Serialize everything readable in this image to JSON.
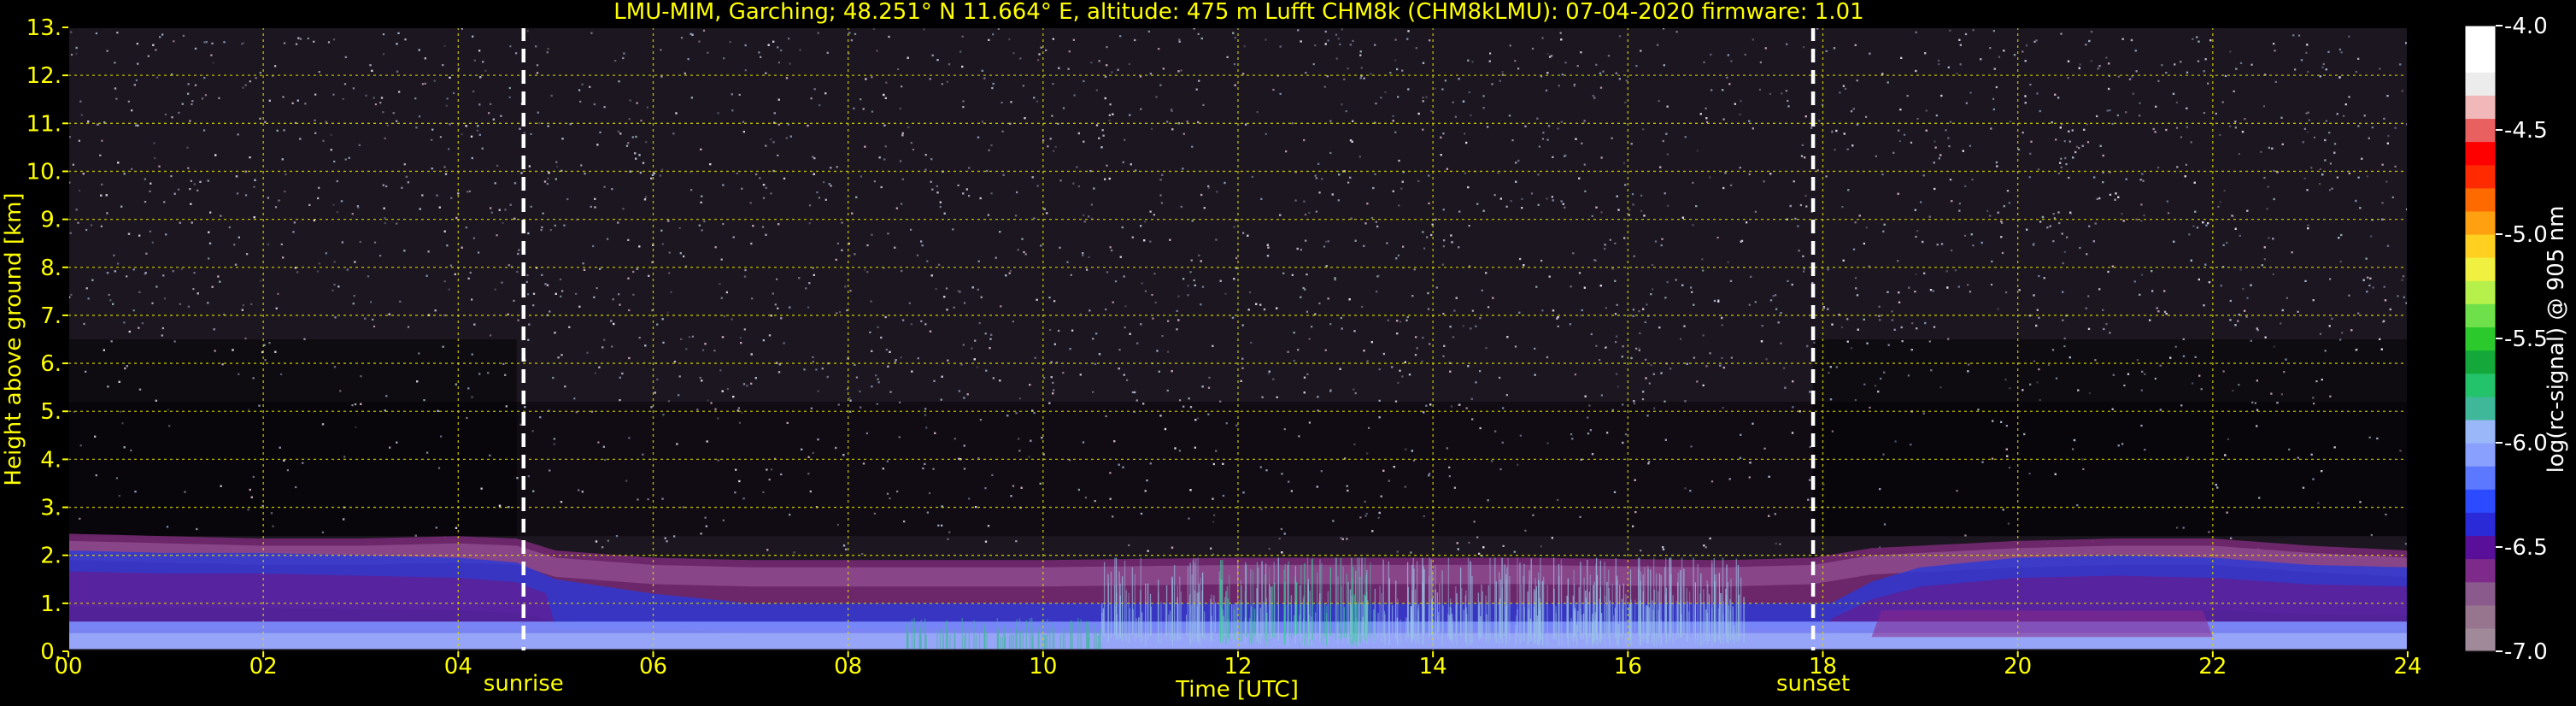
{
  "chart_data": {
    "type": "heatmap",
    "title": "LMU-MIM, Garching; 48.251° N 11.664° E, altitude: 475 m    Lufft CHM8k (CHM8kLMU): 07-04-2020    firmware: 1.01",
    "xlabel": "Time [UTC]",
    "ylabel": "Height above ground [km]",
    "colorbar_label": "log(rc-signal) @ 905 nm",
    "xlim": [
      0,
      24
    ],
    "ylim": [
      0,
      13
    ],
    "clim": [
      -7.0,
      -4.0
    ],
    "grid": true,
    "x_ticks": [
      0,
      2,
      4,
      6,
      8,
      10,
      12,
      14,
      16,
      18,
      20,
      22,
      24
    ],
    "x_tick_labels": [
      "00",
      "02",
      "04",
      "06",
      "08",
      "10",
      "12",
      "14",
      "16",
      "18",
      "20",
      "22",
      "24"
    ],
    "y_ticks": [
      0,
      1,
      2,
      3,
      4,
      5,
      6,
      7,
      8,
      9,
      10,
      11,
      12,
      13
    ],
    "y_tick_labels": [
      "0.",
      "1.",
      "2.",
      "3.",
      "4.",
      "5.",
      "6.",
      "7.",
      "8.",
      "9.",
      "10.",
      "11.",
      "12.",
      "13."
    ],
    "colorbar_ticks": [
      -7.0,
      -6.5,
      -6.0,
      -5.5,
      -5.0,
      -4.5,
      -4.0
    ],
    "colorbar_tick_labels": [
      "-7.0",
      "-6.5",
      "-6.0",
      "-5.5",
      "-5.0",
      "-4.5",
      "-4.0"
    ],
    "colormap": [
      "#a08a9a",
      "#97758f",
      "#8b5a8c",
      "#7e2a8a",
      "#5a0f9a",
      "#2a2ad8",
      "#2c4aff",
      "#5b78ff",
      "#8aa0ff",
      "#9ab8f8",
      "#3fb89a",
      "#22c36a",
      "#14a83a",
      "#2cc92c",
      "#6ee04a",
      "#b6f04a",
      "#f0f040",
      "#ffd020",
      "#ffa010",
      "#ff6a00",
      "#ff2a00",
      "#ff0000",
      "#e86060",
      "#f0b8b8",
      "#ececec",
      "#ffffff",
      "#ffffff"
    ],
    "events": [
      {
        "label": "sunrise",
        "time": 4.67
      },
      {
        "label": "sunset",
        "time": 17.9
      }
    ],
    "boundary_layer": {
      "time": [
        0,
        1,
        2,
        3,
        4,
        4.6,
        5,
        6,
        7,
        8,
        9,
        10,
        10.8,
        12,
        13,
        14,
        15,
        16,
        17,
        17.9,
        18.5,
        19,
        20,
        21,
        22,
        23,
        24
      ],
      "top_km": [
        2.45,
        2.4,
        2.35,
        2.35,
        2.4,
        2.35,
        2.1,
        1.95,
        1.9,
        1.9,
        1.9,
        1.9,
        1.92,
        1.95,
        1.95,
        1.95,
        1.95,
        1.92,
        1.9,
        1.95,
        2.15,
        2.2,
        2.3,
        2.35,
        2.35,
        2.2,
        2.1
      ],
      "mixed_layer_km": [
        1.85,
        1.8,
        1.8,
        1.75,
        1.7,
        1.6,
        1.25,
        0.95,
        0.75,
        0.55,
        0.45,
        0.35,
        0.3,
        0.3,
        0.3,
        0.3,
        0.3,
        0.32,
        0.45,
        0.55,
        1.2,
        1.5,
        1.7,
        1.75,
        1.7,
        1.55,
        1.5
      ]
    }
  }
}
